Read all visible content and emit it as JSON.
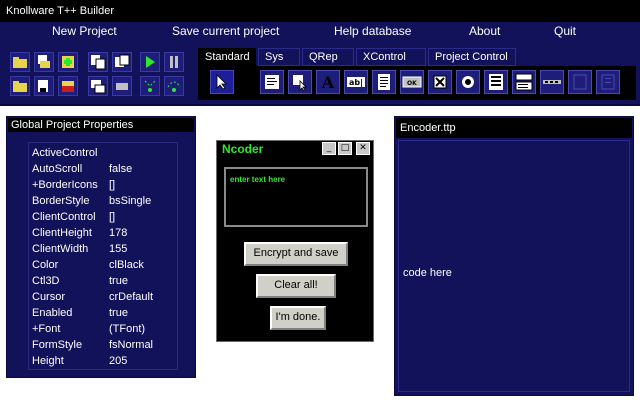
{
  "window": {
    "title": "Knollware T++ Builder"
  },
  "menu": [
    "New Project",
    "Save current project",
    "Help database",
    "About",
    "Quit"
  ],
  "toolbar": {
    "tabs": [
      "Standard",
      "Sys",
      "QRep",
      "XControl",
      "Project Control"
    ],
    "palette_icons": [
      "pointer-icon",
      "main-menu-icon",
      "popup-menu-icon",
      "label-icon",
      "edit-icon",
      "memo-icon",
      "button-icon",
      "checkbox-icon",
      "radio-button-icon",
      "listbox-icon",
      "combobox-icon",
      "scrollbar-icon",
      "groupbox-icon",
      "radiogroup-icon"
    ]
  },
  "properties_panel": {
    "title": "Global Project Properties",
    "rows": [
      {
        "name": "ActiveControl",
        "value": ""
      },
      {
        "name": "AutoScroll",
        "value": "false"
      },
      {
        "name": "+BorderIcons",
        "value": "[]"
      },
      {
        "name": "BorderStyle",
        "value": "bsSingle"
      },
      {
        "name": "ClientControl",
        "value": "[]"
      },
      {
        "name": "ClientHeight",
        "value": "178"
      },
      {
        "name": "ClientWidth",
        "value": "155"
      },
      {
        "name": "Color",
        "value": "clBlack"
      },
      {
        "name": "Ctl3D",
        "value": "true"
      },
      {
        "name": "Cursor",
        "value": "crDefault"
      },
      {
        "name": "Enabled",
        "value": "true"
      },
      {
        "name": "+Font",
        "value": "(TFont)"
      },
      {
        "name": "FormStyle",
        "value": "fsNormal"
      },
      {
        "name": "Height",
        "value": "205"
      }
    ]
  },
  "ncoder": {
    "title": "Ncoder",
    "input_placeholder": "enter text here",
    "buttons": {
      "encrypt": "Encrypt and save",
      "clear": "Clear all!",
      "done": "I'm done."
    }
  },
  "encoder_panel": {
    "title": "Encoder.ttp",
    "code": "code here"
  },
  "colors": {
    "background": "#12125a",
    "accent_green": "#2ee82e",
    "black": "#000000"
  }
}
